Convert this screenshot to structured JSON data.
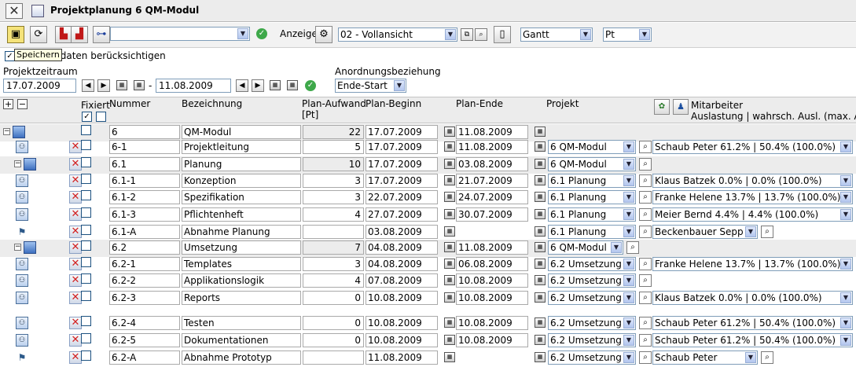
{
  "window": {
    "title": "Projektplanung 6 QM-Modul"
  },
  "toolbar": {
    "view_label": "Anzeige",
    "view_value": "02 - Vollansicht",
    "mode_value": "Gantt",
    "unit_value": "Pt",
    "save_tooltip": "Speichern"
  },
  "options": {
    "consider_label": "rdaten berücksichtigen"
  },
  "period": {
    "label": "Projektzeitraum",
    "start": "17.07.2009",
    "sep": "-",
    "end": "11.08.2009"
  },
  "relation": {
    "label": "Anordnungsbeziehung",
    "value": "Ende-Start"
  },
  "columns": {
    "fixed": "Fixiert",
    "number": "Nummer",
    "name": "Bezeichnung",
    "effort": "Plan-Aufwand",
    "effort_unit": "[Pt]",
    "start": "Plan-Beginn",
    "end": "Plan-Ende",
    "project": "Projekt",
    "staff": "Mitarbeiter",
    "staff_sub": "Auslastung | wahrsch. Ausl. (max. Ausl"
  },
  "rows": [
    {
      "nr": "6",
      "name": "QM-Modul",
      "effort": "22",
      "start": "17.07.2009",
      "end": "11.08.2009",
      "project": "",
      "staff": ""
    },
    {
      "nr": "6-1",
      "name": "Projektleitung",
      "effort": "5",
      "start": "17.07.2009",
      "end": "11.08.2009",
      "project": "6 QM-Modul",
      "staff": "Schaub Peter 61.2% | 50.4% (100.0%)"
    },
    {
      "nr": "6.1",
      "name": "Planung",
      "effort": "10",
      "start": "17.07.2009",
      "end": "03.08.2009",
      "project": "6 QM-Modul",
      "staff": ""
    },
    {
      "nr": "6.1-1",
      "name": "Konzeption",
      "effort": "3",
      "start": "17.07.2009",
      "end": "21.07.2009",
      "project": "6.1 Planung",
      "staff": "Klaus Batzek 0.0% | 0.0% (100.0%)"
    },
    {
      "nr": "6.1-2",
      "name": "Spezifikation",
      "effort": "3",
      "start": "22.07.2009",
      "end": "24.07.2009",
      "project": "6.1 Planung",
      "staff": "Franke Helene 13.7% | 13.7% (100.0%)"
    },
    {
      "nr": "6.1-3",
      "name": "Pflichtenheft",
      "effort": "4",
      "start": "27.07.2009",
      "end": "30.07.2009",
      "project": "6.1 Planung",
      "staff": "Meier Bernd 4.4% | 4.4% (100.0%)"
    },
    {
      "nr": "6.1-A",
      "name": "Abnahme Planung",
      "effort": "",
      "start": "03.08.2009",
      "end": "",
      "project": "6.1 Planung",
      "staff": "Beckenbauer Sepp"
    },
    {
      "nr": "6.2",
      "name": "Umsetzung",
      "effort": "7",
      "start": "04.08.2009",
      "end": "11.08.2009",
      "project": "6 QM-Modul",
      "staff": ""
    },
    {
      "nr": "6.2-1",
      "name": "Templates",
      "effort": "3",
      "start": "04.08.2009",
      "end": "06.08.2009",
      "project": "6.2 Umsetzung",
      "staff": "Franke Helene 13.7% | 13.7% (100.0%)"
    },
    {
      "nr": "6.2-2",
      "name": "Applikationslogik",
      "effort": "4",
      "start": "07.08.2009",
      "end": "10.08.2009",
      "project": "6.2 Umsetzung",
      "staff": ""
    },
    {
      "nr": "6.2-3",
      "name": "Reports",
      "effort": "0",
      "start": "10.08.2009",
      "end": "10.08.2009",
      "project": "6.2 Umsetzung",
      "staff": "Klaus Batzek 0.0% | 0.0% (100.0%)"
    },
    {
      "nr": "6.2-4",
      "name": "Testen",
      "effort": "0",
      "start": "10.08.2009",
      "end": "10.08.2009",
      "project": "6.2 Umsetzung",
      "staff": "Schaub Peter 61.2% | 50.4% (100.0%)"
    },
    {
      "nr": "6.2-5",
      "name": "Dokumentationen",
      "effort": "0",
      "start": "10.08.2009",
      "end": "10.08.2009",
      "project": "6.2 Umsetzung",
      "staff": "Schaub Peter 61.2% | 50.4% (100.0%)"
    },
    {
      "nr": "6.2-A",
      "name": "Abnahme Prototyp",
      "effort": "",
      "start": "11.08.2009",
      "end": "",
      "project": "6.2 Umsetzung",
      "staff": "Schaub Peter"
    }
  ]
}
